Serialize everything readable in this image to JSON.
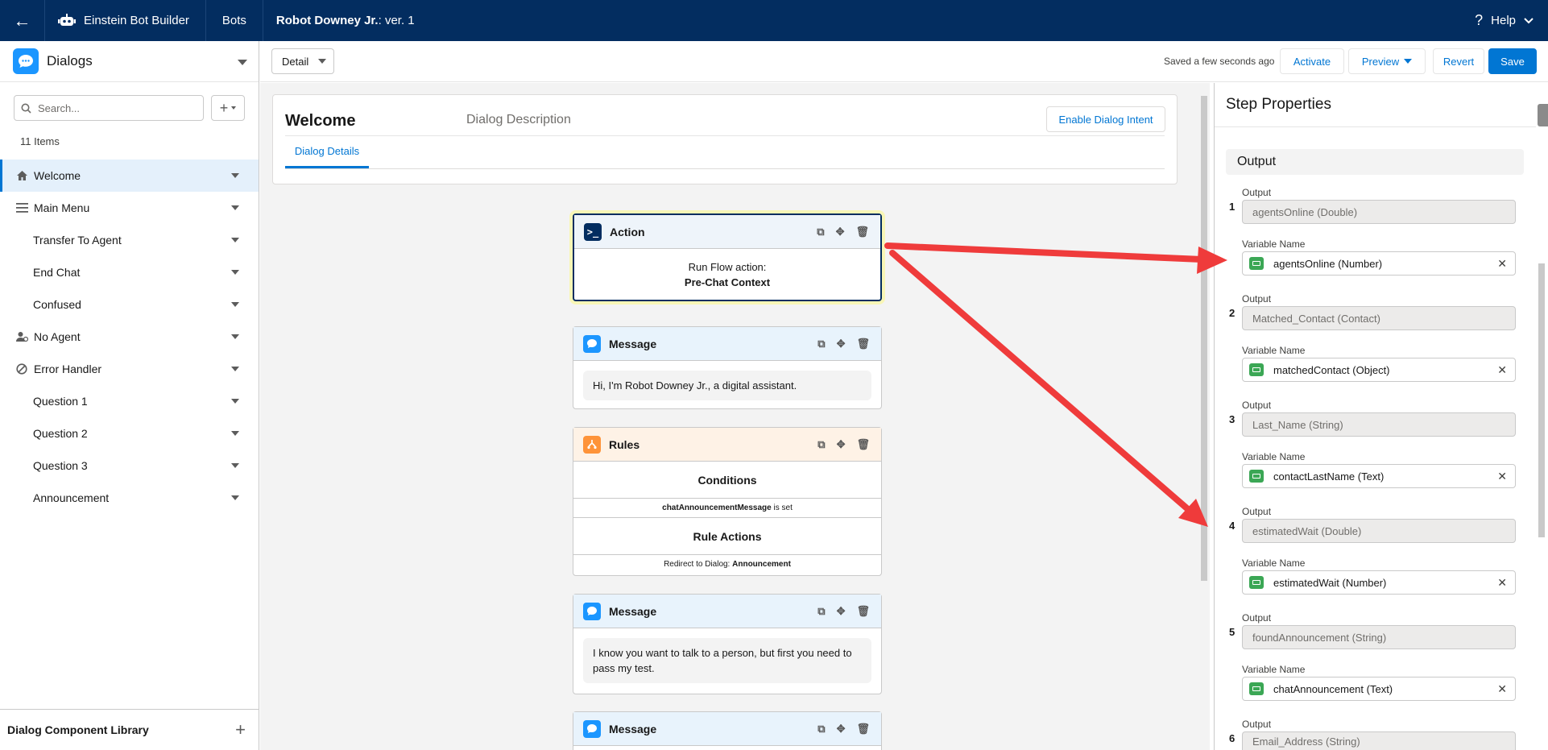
{
  "topbar": {
    "app_name": "Einstein Bot Builder",
    "bots_label": "Bots",
    "bot_name": "Robot Downey Jr.",
    "version": " : ver. 1",
    "help_label": "Help"
  },
  "sidebar": {
    "title": "Dialogs",
    "search_placeholder": "Search...",
    "count": "11 Items",
    "items": [
      {
        "label": "Welcome"
      },
      {
        "label": "Main Menu"
      },
      {
        "label": "Transfer To Agent"
      },
      {
        "label": "End Chat"
      },
      {
        "label": "Confused"
      },
      {
        "label": "No Agent"
      },
      {
        "label": "Error Handler"
      },
      {
        "label": "Question 1"
      },
      {
        "label": "Question 2"
      },
      {
        "label": "Question 3"
      },
      {
        "label": "Announcement"
      }
    ],
    "footer": "Dialog Component Library"
  },
  "toolbar": {
    "view": "Detail",
    "saved": "Saved a few seconds ago",
    "activate": "Activate",
    "preview": "Preview",
    "revert": "Revert",
    "save": "Save"
  },
  "dialog": {
    "title": "Welcome",
    "description": "Dialog Description",
    "enable_intent": "Enable Dialog Intent",
    "tab": "Dialog Details"
  },
  "steps": {
    "action": {
      "label": "Action",
      "line1": "Run Flow action:",
      "line2": "Pre-Chat Context"
    },
    "message1": {
      "label": "Message",
      "text": "Hi, I'm Robot Downey Jr., a digital assistant."
    },
    "rules": {
      "label": "Rules",
      "conditions": "Conditions",
      "condition_var": "chatAnnouncementMessage",
      "condition_op": " is set",
      "rule_actions": "Rule Actions",
      "redirect_prefix": "Redirect to Dialog: ",
      "redirect_target": "Announcement"
    },
    "message2": {
      "label": "Message",
      "text": "I know you want to talk to a person, but first you need to pass my test."
    },
    "message3": {
      "label": "Message"
    }
  },
  "properties": {
    "title": "Step Properties",
    "section": "Output",
    "output_label": "Output",
    "variable_label": "Variable Name",
    "rows": [
      {
        "num": "1",
        "output": "agentsOnline (Double)",
        "variable": "agentsOnline (Number)"
      },
      {
        "num": "2",
        "output": "Matched_Contact (Contact)",
        "variable": "matchedContact (Object)"
      },
      {
        "num": "3",
        "output": "Last_Name (String)",
        "variable": "contactLastName (Text)"
      },
      {
        "num": "4",
        "output": "estimatedWait (Double)",
        "variable": "estimatedWait (Number)"
      },
      {
        "num": "5",
        "output": "foundAnnouncement (String)",
        "variable": "chatAnnouncement (Text)"
      },
      {
        "num": "6",
        "output": "Email_Address (String)"
      }
    ]
  },
  "colors": {
    "nav": "#032d60",
    "brand": "#0176d3",
    "arrow": "#ef3b3b",
    "variable_icon": "#3ba755",
    "rules_icon": "#fe9339"
  }
}
